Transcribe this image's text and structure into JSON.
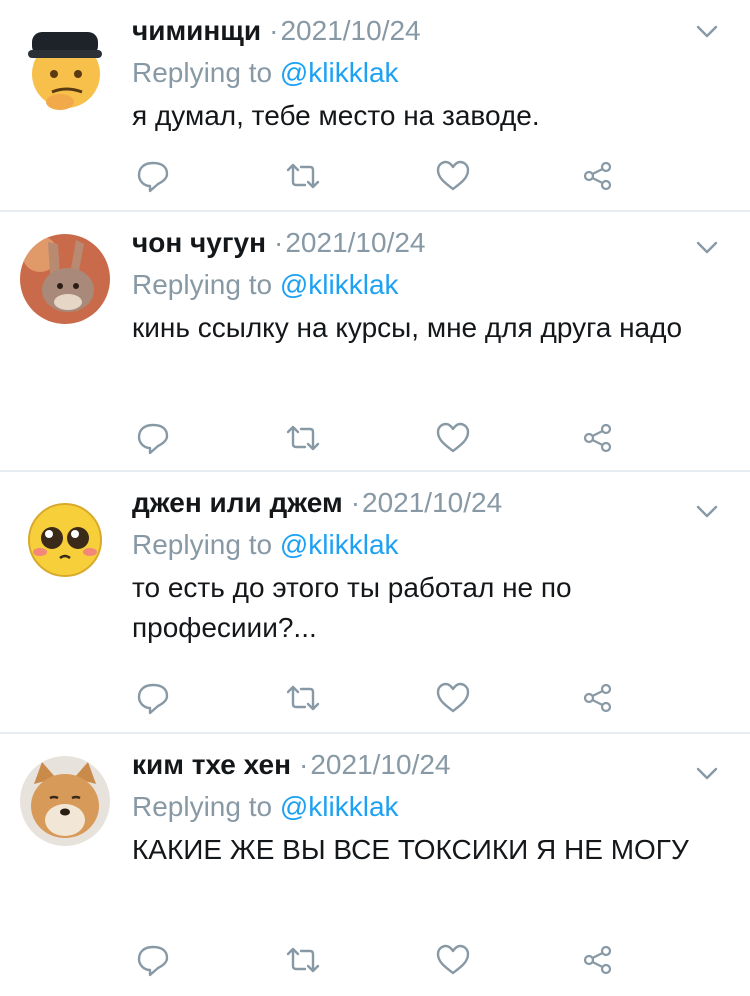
{
  "colors": {
    "link": "#1da1f2",
    "muted": "#8899a6",
    "text": "#14171a",
    "divider": "#e6ecf0"
  },
  "icons": [
    "reply-icon",
    "retweet-icon",
    "like-icon",
    "share-icon",
    "chevron-down-icon"
  ],
  "tweets": [
    {
      "name": "чиминщи",
      "date": "2021/10/24",
      "replying_label": "Replying to",
      "handle": "@klikklak",
      "text": "я думал, тебе место на заводе.",
      "avatar": "thinking-emoji-avatar"
    },
    {
      "name": "чон чугун",
      "date": "2021/10/24",
      "replying_label": "Replying to",
      "handle": "@klikklak",
      "text": "кинь ссылку на курсы, мне для друга надо",
      "avatar": "bunny-avatar"
    },
    {
      "name": "джен или джем",
      "date": "2021/10/24",
      "replying_label": "Replying to",
      "handle": "@klikklak",
      "text": "то есть до этого ты работал не по професиии?...",
      "avatar": "pleading-face-avatar"
    },
    {
      "name": "ким тхе хен",
      "date": "2021/10/24",
      "replying_label": "Replying to",
      "handle": "@klikklak",
      "text": "КАКИЕ ЖЕ ВЫ ВСЕ ТОКСИКИ Я НЕ МОГУ",
      "avatar": "shiba-dog-avatar"
    }
  ]
}
